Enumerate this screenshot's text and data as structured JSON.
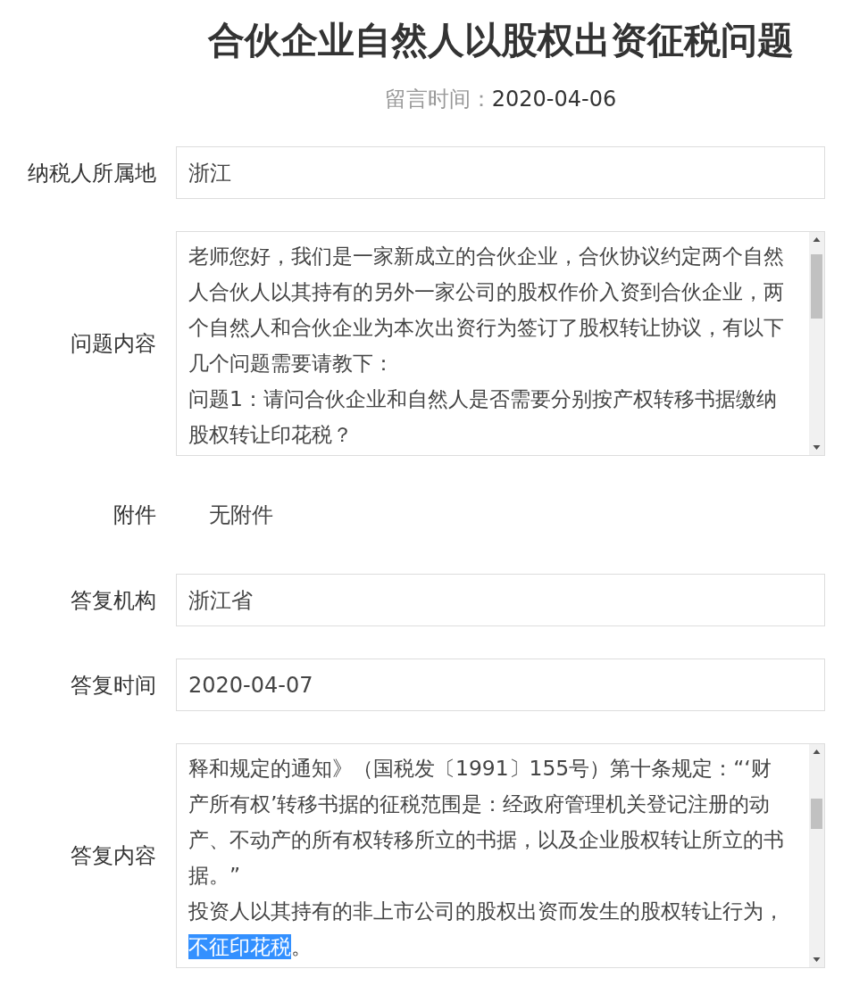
{
  "title": "合伙企业自然人以股权出资征税问题",
  "message_time": {
    "label": "留言时间：",
    "value": "2020-04-06"
  },
  "fields": [
    {
      "kind": "input",
      "label": "纳税人所属地",
      "value": "浙江"
    },
    {
      "kind": "textarea",
      "label": "问题内容",
      "paragraphs": [
        [
          {
            "text": "老师您好，我们是一家新成立的合伙企业，合伙协议约定两个自然人合伙人以其持有的另外一家公司的股权作价入资到合伙企业，两个自然人和合伙企业为本次出资行为签订了股权转让协议，有以下几个问题需要请教下：",
            "selected": false
          }
        ],
        [
          {
            "text": "问题1：请问合伙企业和自然人是否需要分别按产权转移书据缴纳股权转让印花税？",
            "selected": false
          }
        ]
      ]
    },
    {
      "kind": "plain",
      "label": "附件",
      "value": "无附件"
    },
    {
      "kind": "input",
      "label": "答复机构",
      "value": "浙江省"
    },
    {
      "kind": "input",
      "label": "答复时间",
      "value": "2020-04-07"
    },
    {
      "kind": "textarea",
      "label": "答复内容",
      "paragraphs": [
        [
          {
            "text": "释和规定的通知》（国税发〔1991〕155号）第十条规定：“‘财产所有权’转移书据的征税范围是：经政府管理机关登记注册的动产、不动产的所有权转移所立的书据，以及企业股权转让所立的书据。”",
            "selected": false
          }
        ],
        [
          {
            "text": "投资人以其持有的非上市公司的股权出资而发生的股权转让行为，",
            "selected": false
          },
          {
            "text": "不征印花税",
            "selected": true
          },
          {
            "text": "。",
            "selected": false
          }
        ]
      ]
    }
  ]
}
